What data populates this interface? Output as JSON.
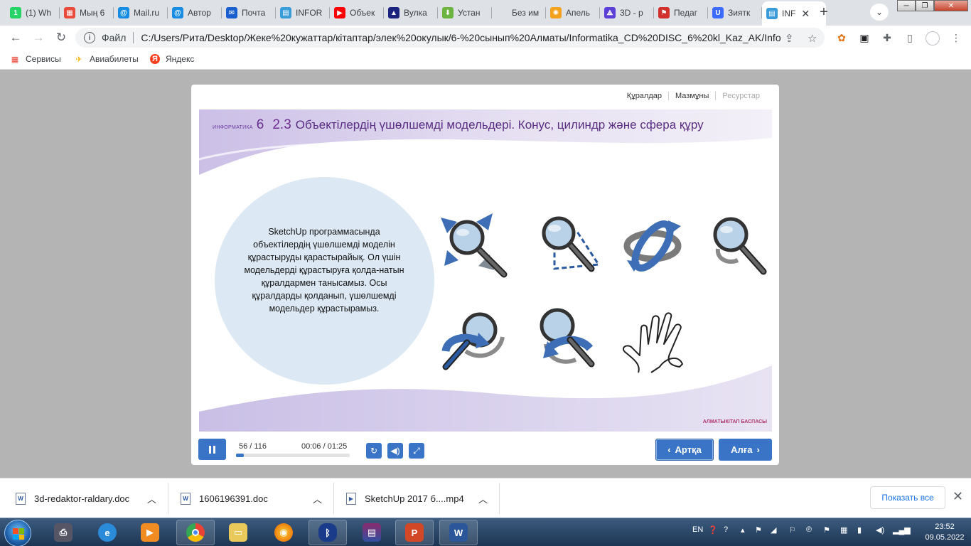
{
  "browser": {
    "tabs": [
      {
        "label": "(1) Wh",
        "icon": "whatsapp-icon",
        "color": "#25d366",
        "glyph": "1"
      },
      {
        "label": "Мың 6",
        "icon": "grid-app-icon",
        "color": "#e84b3c",
        "glyph": "▦"
      },
      {
        "label": "Mail.ru",
        "icon": "mailru-icon",
        "color": "#168de2",
        "glyph": "@"
      },
      {
        "label": "Автор",
        "icon": "mailru-icon",
        "color": "#168de2",
        "glyph": "@"
      },
      {
        "label": "Почта",
        "icon": "mail-icon",
        "color": "#1a5fd0",
        "glyph": "✉"
      },
      {
        "label": "INFOR",
        "icon": "document-icon",
        "color": "#3a9bd9",
        "glyph": "▤"
      },
      {
        "label": "Объек",
        "icon": "youtube-icon",
        "color": "#ff0000",
        "glyph": "▶"
      },
      {
        "label": "Вулка",
        "icon": "vulkan-icon",
        "color": "#1a237e",
        "glyph": "▲"
      },
      {
        "label": "Устан",
        "icon": "download-icon",
        "color": "#6cb33f",
        "glyph": "⬇"
      },
      {
        "label": "Без им",
        "icon": "blank-page-icon",
        "color": "#dee1e6",
        "glyph": ""
      },
      {
        "label": "Апель",
        "icon": "orange-icon",
        "color": "#f4a21d",
        "glyph": "✺"
      },
      {
        "label": "3D - р",
        "icon": "3d-icon",
        "color": "#5b3fd6",
        "glyph": "⟁"
      },
      {
        "label": "Педаг",
        "icon": "flag-icon",
        "color": "#d0312d",
        "glyph": "⚑"
      },
      {
        "label": "Зиятк",
        "icon": "u-icon",
        "color": "#3d6bff",
        "glyph": "U"
      },
      {
        "label": "INF",
        "icon": "document-icon",
        "color": "#3a9bd9",
        "glyph": "▤"
      }
    ],
    "address": {
      "scheme": "Файл",
      "url": "C:/Users/Рита/Desktop/Жеке%20кужаттар/кітаптар/элек%20окулык/6-%20сынып%20Алматы/Informatika_CD%20DISC_6%20kl_Kaz_AK/Infor..."
    },
    "bookmarks": [
      {
        "label": "Сервисы",
        "icon": "apps-grid-icon"
      },
      {
        "label": "Авиабилеты",
        "icon": "airplane-icon"
      },
      {
        "label": "Яндекс",
        "icon": "yandex-icon"
      }
    ]
  },
  "player": {
    "top_nav": [
      "Құралдар",
      "Мазмұны",
      "Ресурстар"
    ],
    "slide": {
      "brand": "ИНФОРМАТИКА",
      "grade": "6",
      "section": "2.3",
      "title": "Объектілердің үшөлшемді модельдері. Конус, цилиндр және сфера құру",
      "body": "SketchUp программасында объектілердің үшөлшемді моделін құрастыруды қарастырайық. Ол үшін модельдерді құрастыруға қолда-натын құралдармен танысамыз. Осы құралдарды қолданып, үшөлшемді модельдер құрастырамыз.",
      "publisher": "АЛМАТЫКІТАП БАСПАСЫ",
      "tools": [
        "zoom-extents-icon",
        "zoom-window-icon",
        "orbit-icon",
        "zoom-icon",
        "previous-view-icon",
        "next-view-icon",
        "pan-hand-icon"
      ]
    },
    "controls": {
      "counter": "56 / 116",
      "time": "00:06 / 01:25",
      "progress": 0.07,
      "back_label": "Артқа",
      "next_label": "Алға"
    }
  },
  "downloads": {
    "items": [
      "3d-redaktor-raldary.doc",
      "1606196391.doc",
      "SketchUp 2017 б....mp4"
    ],
    "show_all": "Показать все"
  },
  "taskbar": {
    "lang": "EN",
    "time": "23:52",
    "date": "09.05.2022"
  },
  "colors": {
    "accent_blue": "#3a74c7",
    "title_purple": "#5a2d82",
    "circle_bg": "#dce8f3",
    "publisher_red": "#b1366e"
  }
}
